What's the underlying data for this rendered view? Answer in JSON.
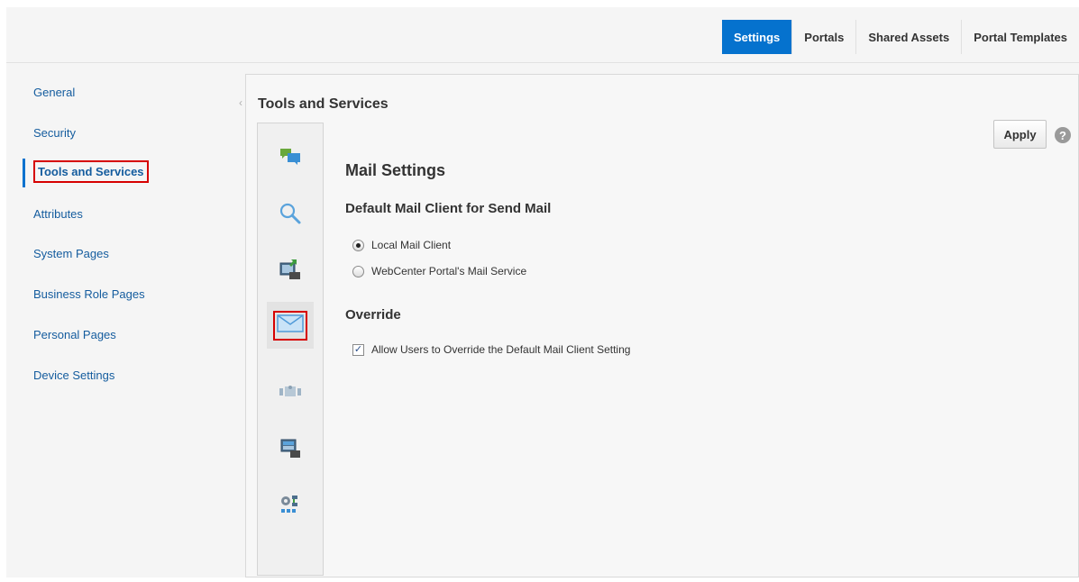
{
  "tabs": [
    {
      "label": "Settings",
      "active": true
    },
    {
      "label": "Portals",
      "active": false
    },
    {
      "label": "Shared Assets",
      "active": false
    },
    {
      "label": "Portal Templates",
      "active": false
    }
  ],
  "nav": [
    {
      "label": "General"
    },
    {
      "label": "Security"
    },
    {
      "label": "Tools and Services",
      "selected": true
    },
    {
      "label": "Attributes"
    },
    {
      "label": "System Pages"
    },
    {
      "label": "Business Role Pages"
    },
    {
      "label": "Personal Pages"
    },
    {
      "label": "Device Settings"
    }
  ],
  "main": {
    "title": "Tools and Services",
    "collapse_glyph": "‹",
    "apply_label": "Apply",
    "help_glyph": "?",
    "heading": "Mail Settings",
    "default_client_heading": "Default Mail Client for Send Mail",
    "options": [
      {
        "label": "Local Mail Client",
        "checked": true
      },
      {
        "label": "WebCenter Portal's Mail Service",
        "checked": false
      }
    ],
    "override_heading": "Override",
    "override_checkbox": {
      "label": "Allow Users to Override the Default Mail Client Setting",
      "checked": true,
      "glyph": "✓"
    }
  },
  "strip_icons": [
    "discussions-icon",
    "search-icon",
    "export-icon",
    "mail-icon",
    "people-icon",
    "presence-icon",
    "workflow-icon"
  ],
  "colors": {
    "accent": "#0572ce",
    "link": "#145c9e",
    "highlight": "#d60000"
  }
}
